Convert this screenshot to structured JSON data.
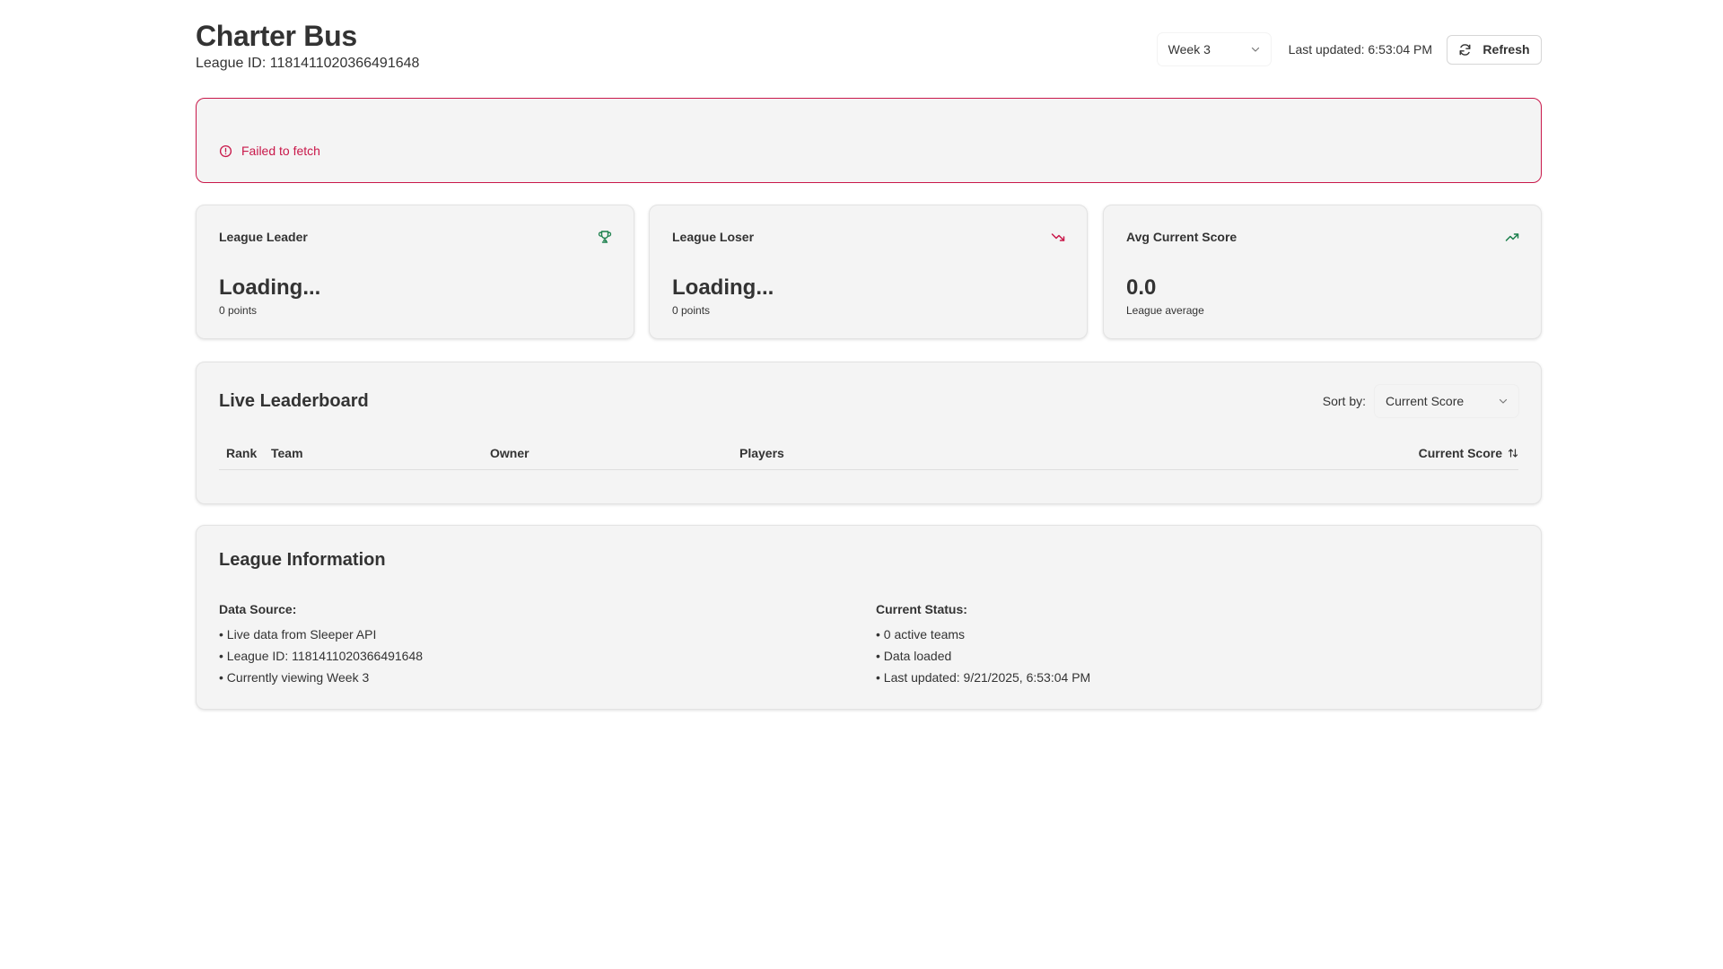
{
  "header": {
    "title": "Charter Bus",
    "league_id_text": "League ID: 1181411020366491648",
    "week_select": {
      "value": "Week 3"
    },
    "last_updated": "Last updated: 6:53:04 PM",
    "refresh_label": "Refresh"
  },
  "error": {
    "message": "Failed to fetch"
  },
  "stats": [
    {
      "label": "League Leader",
      "value": "Loading...",
      "sub": "0 points",
      "icon": "trophy-icon"
    },
    {
      "label": "League Loser",
      "value": "Loading...",
      "sub": "0 points",
      "icon": "trending-down-icon"
    },
    {
      "label": "Avg Current Score",
      "value": "0.0",
      "sub": "League average",
      "icon": "trending-up-icon"
    }
  ],
  "leaderboard": {
    "title": "Live Leaderboard",
    "sort_label": "Sort by:",
    "sort_value": "Current Score",
    "columns": [
      "Rank",
      "Team",
      "Owner",
      "Players",
      "Current Score"
    ],
    "rows": []
  },
  "info": {
    "title": "League Information",
    "data_source": {
      "heading": "Data Source:",
      "items": [
        "• Live data from Sleeper API",
        "• League ID: 1181411020366491648",
        "• Currently viewing Week 3"
      ]
    },
    "current_status": {
      "heading": "Current Status:",
      "items": [
        "• 0 active teams",
        "• Data loaded",
        "• Last updated: 9/21/2025, 6:53:04 PM"
      ]
    }
  },
  "colors": {
    "error": "#c9184a",
    "positive": "#1a7f4b",
    "negative": "#c9184a",
    "card_bg": "#f4f4f4"
  }
}
